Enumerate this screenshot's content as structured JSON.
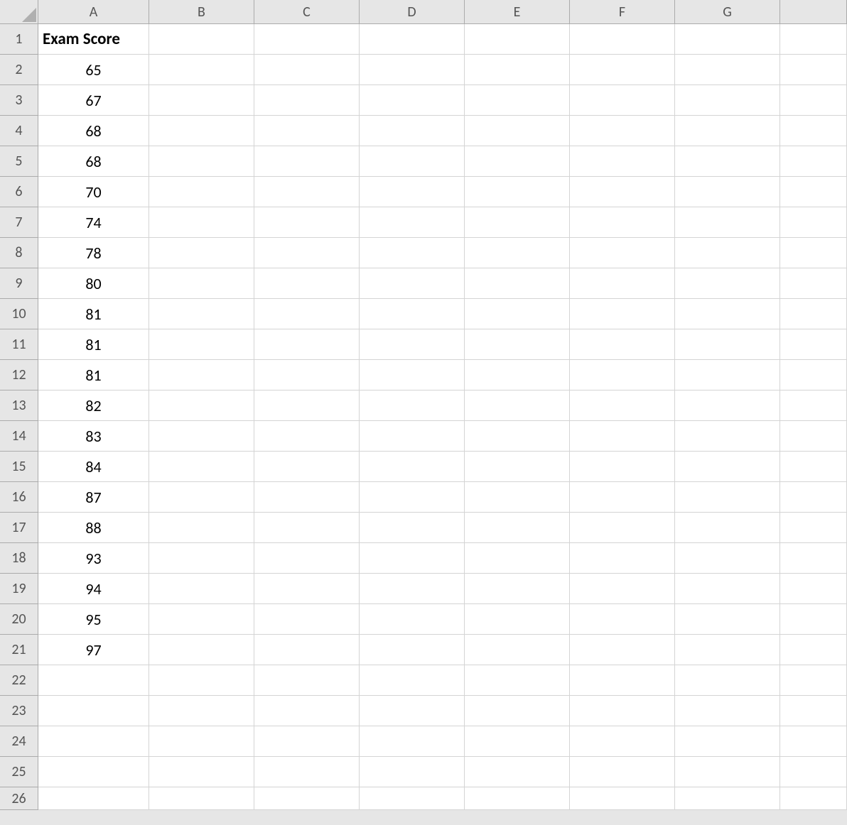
{
  "columns": [
    "A",
    "B",
    "C",
    "D",
    "E",
    "F",
    "G"
  ],
  "row_count": 26,
  "cells": {
    "A1": {
      "value": "Exam Score",
      "bold": true,
      "align": "left"
    },
    "A2": {
      "value": "65",
      "align": "center"
    },
    "A3": {
      "value": "67",
      "align": "center"
    },
    "A4": {
      "value": "68",
      "align": "center"
    },
    "A5": {
      "value": "68",
      "align": "center"
    },
    "A6": {
      "value": "70",
      "align": "center"
    },
    "A7": {
      "value": "74",
      "align": "center"
    },
    "A8": {
      "value": "78",
      "align": "center"
    },
    "A9": {
      "value": "80",
      "align": "center"
    },
    "A10": {
      "value": "81",
      "align": "center"
    },
    "A11": {
      "value": "81",
      "align": "center"
    },
    "A12": {
      "value": "81",
      "align": "center"
    },
    "A13": {
      "value": "82",
      "align": "center"
    },
    "A14": {
      "value": "83",
      "align": "center"
    },
    "A15": {
      "value": "84",
      "align": "center"
    },
    "A16": {
      "value": "87",
      "align": "center"
    },
    "A17": {
      "value": "88",
      "align": "center"
    },
    "A18": {
      "value": "93",
      "align": "center"
    },
    "A19": {
      "value": "94",
      "align": "center"
    },
    "A20": {
      "value": "95",
      "align": "center"
    },
    "A21": {
      "value": "97",
      "align": "center"
    }
  }
}
